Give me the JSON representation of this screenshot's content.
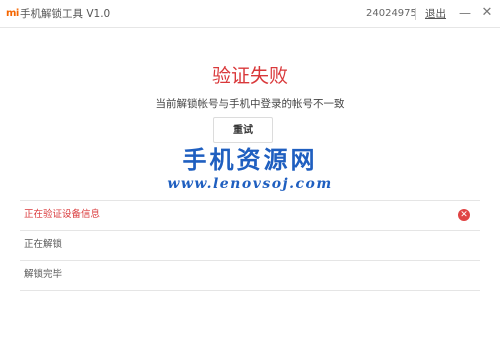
{
  "titlebar": {
    "logo_text": "mi",
    "app_title": "手机解锁工具 V1.0",
    "account_id": "24024975",
    "logout_label": "退出",
    "minimize_glyph": "—",
    "close_glyph": "✕"
  },
  "result": {
    "headline": "验证失败",
    "message": "当前解锁帐号与手机中登录的帐号不一致",
    "retry_label": "重试"
  },
  "watermark": {
    "title": "手机资源网",
    "url": "www.lenovsoj.com"
  },
  "steps": [
    {
      "label": "正在验证设备信息",
      "status": "error"
    },
    {
      "label": "正在解锁",
      "status": "pending"
    },
    {
      "label": "解锁完毕",
      "status": "pending"
    }
  ],
  "icons": {
    "error": "error-icon"
  },
  "colors": {
    "brand": "#f56600",
    "error": "#d9383a",
    "watermark": "#1f5fc0"
  }
}
